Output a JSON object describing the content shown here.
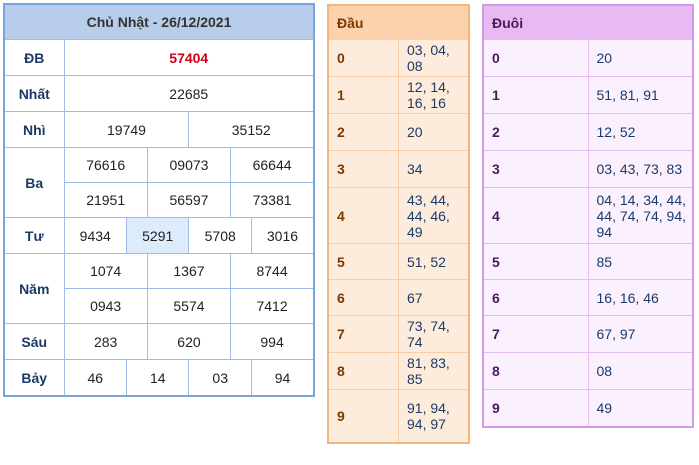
{
  "results": {
    "date_title": "Chủ Nhật - 26/12/2021",
    "prizes": {
      "db": {
        "label": "ĐB",
        "values": [
          "57404"
        ]
      },
      "nhat": {
        "label": "Nhất",
        "values": [
          "22685"
        ]
      },
      "nhi": {
        "label": "Nhì",
        "values": [
          "19749",
          "35152"
        ]
      },
      "ba": {
        "label": "Ba",
        "values": [
          "76616",
          "09073",
          "66644",
          "21951",
          "56597",
          "73381"
        ]
      },
      "tu": {
        "label": "Tư",
        "values": [
          "9434",
          "5291",
          "5708",
          "3016"
        ]
      },
      "nam": {
        "label": "Năm",
        "values": [
          "1074",
          "1367",
          "8744",
          "0943",
          "5574",
          "7412"
        ]
      },
      "sau": {
        "label": "Sáu",
        "values": [
          "283",
          "620",
          "994"
        ]
      },
      "bay": {
        "label": "Bảy",
        "values": [
          "46",
          "14",
          "03",
          "94"
        ]
      }
    }
  },
  "dau": {
    "header": "Đầu",
    "rows": [
      {
        "k": "0",
        "v": "03, 04, 08"
      },
      {
        "k": "1",
        "v": "12, 14, 16, 16"
      },
      {
        "k": "2",
        "v": "20"
      },
      {
        "k": "3",
        "v": "34"
      },
      {
        "k": "4",
        "v": "43, 44, 44, 46, 49"
      },
      {
        "k": "5",
        "v": "51, 52"
      },
      {
        "k": "6",
        "v": "67"
      },
      {
        "k": "7",
        "v": "73, 74, 74"
      },
      {
        "k": "8",
        "v": "81, 83, 85"
      },
      {
        "k": "9",
        "v": "91, 94, 94, 97"
      }
    ]
  },
  "duoi": {
    "header": "Đuôi",
    "rows": [
      {
        "k": "0",
        "v": "20"
      },
      {
        "k": "1",
        "v": "51, 81, 91"
      },
      {
        "k": "2",
        "v": "12, 52"
      },
      {
        "k": "3",
        "v": "03, 43, 73, 83"
      },
      {
        "k": "4",
        "v": "04, 14, 34, 44, 44, 74, 74, 94, 94"
      },
      {
        "k": "5",
        "v": "85"
      },
      {
        "k": "6",
        "v": "16, 16, 46"
      },
      {
        "k": "7",
        "v": "67, 97"
      },
      {
        "k": "8",
        "v": "08"
      },
      {
        "k": "9",
        "v": "49"
      }
    ]
  },
  "colors": {
    "result_border": "#7aa2df",
    "special_prize": "#d0021b",
    "dau_bg": "#fdecdc",
    "duoi_bg": "#fbf0fe"
  }
}
